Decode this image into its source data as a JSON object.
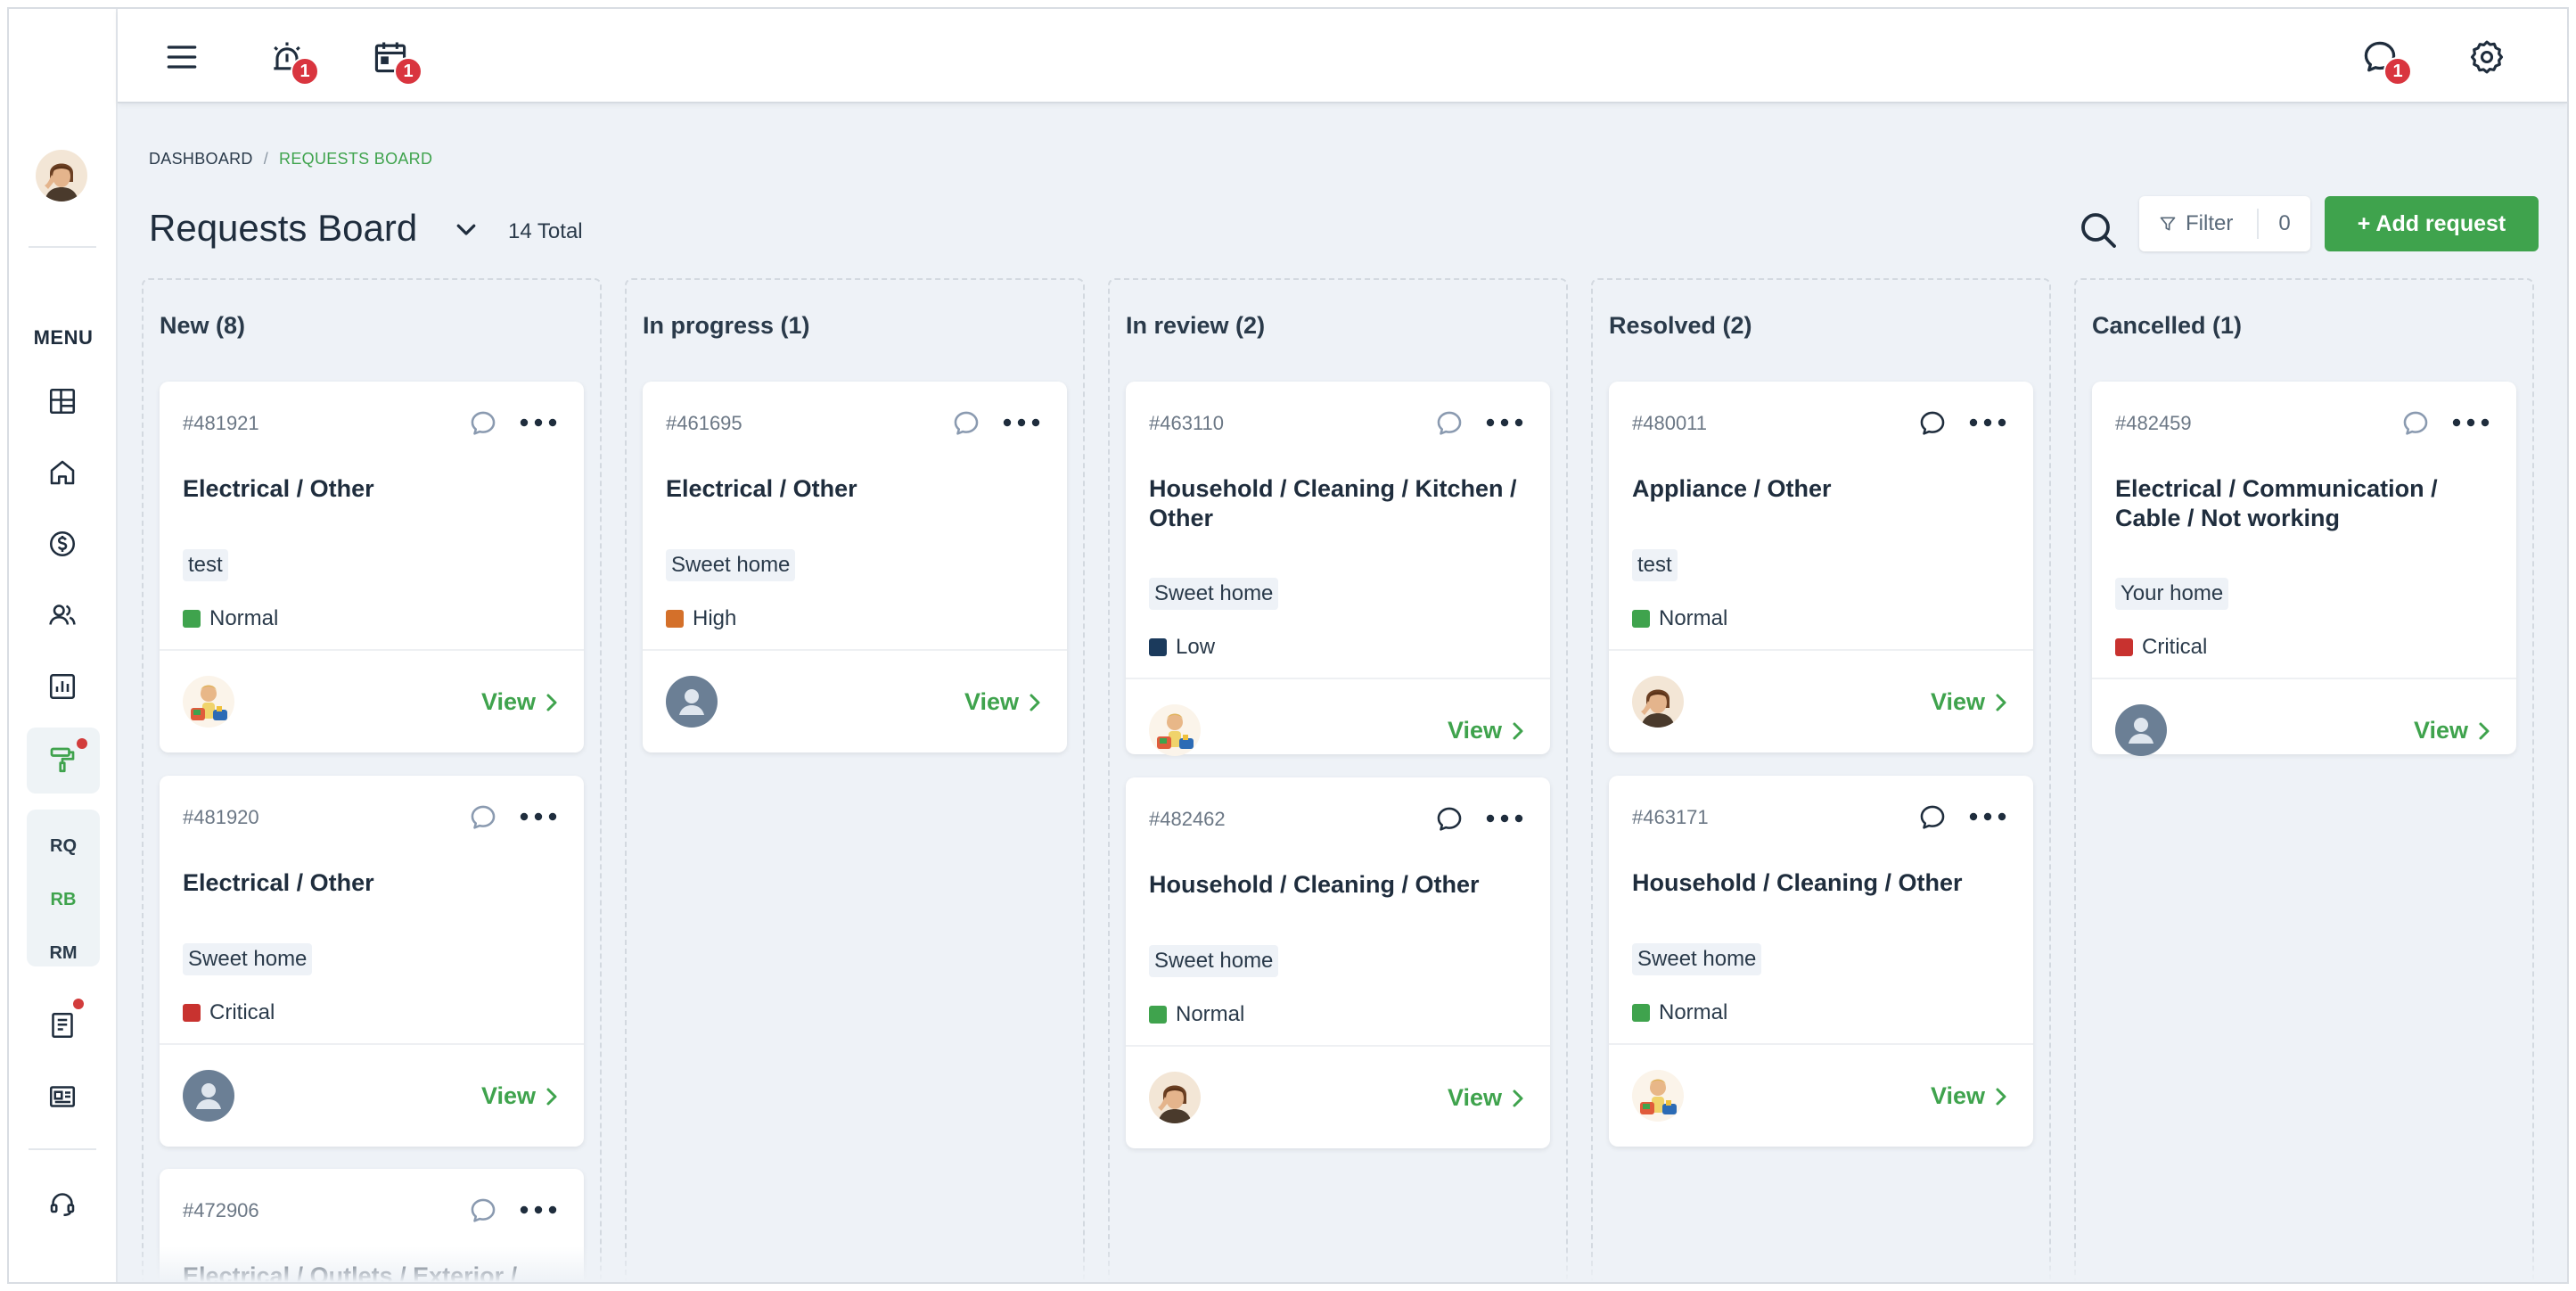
{
  "topbar": {
    "alarm_badge": "1",
    "calendar_badge": "1",
    "chat_badge": "1"
  },
  "sidebar": {
    "menu_label": "MENU",
    "sub_items": [
      "RQ",
      "RB",
      "RM"
    ]
  },
  "breadcrumb": {
    "items": [
      "DASHBOARD",
      "REQUESTS BOARD"
    ],
    "separator": "/"
  },
  "header": {
    "title": "Requests Board",
    "total": "14 Total",
    "filter_label": "Filter",
    "filter_count": "0",
    "add_label": "+ Add request"
  },
  "colors": {
    "accent": "#3fa34d",
    "normal": "#3fa34d",
    "high": "#d4702a",
    "low": "#1b3a5c",
    "critical": "#c8322f"
  },
  "columns": [
    {
      "title": "New (8)",
      "cards": [
        {
          "id": "#481921",
          "title": "Electrical / Other",
          "tag": "test",
          "priority": "Normal",
          "view": "View"
        },
        {
          "id": "#481920",
          "title": "Electrical / Other",
          "tag": "Sweet home",
          "priority": "Critical",
          "view": "View"
        },
        {
          "id": "#472906",
          "title": "Electrical / Outlets / Exterior / Not"
        }
      ]
    },
    {
      "title": "In progress (1)",
      "cards": [
        {
          "id": "#461695",
          "title": "Electrical / Other",
          "tag": "Sweet home",
          "priority": "High",
          "view": "View"
        }
      ]
    },
    {
      "title": "In review (2)",
      "cards": [
        {
          "id": "#463110",
          "title": "Household / Cleaning / Kitchen / Other",
          "tag": "Sweet home",
          "priority": "Low",
          "view": "View"
        },
        {
          "id": "#482462",
          "title": "Household / Cleaning / Other",
          "tag": "Sweet home",
          "priority": "Normal",
          "view": "View"
        }
      ]
    },
    {
      "title": "Resolved (2)",
      "cards": [
        {
          "id": "#480011",
          "title": "Appliance / Other",
          "tag": "test",
          "priority": "Normal",
          "view": "View"
        },
        {
          "id": "#463171",
          "title": "Household / Cleaning / Other",
          "tag": "Sweet home",
          "priority": "Normal",
          "view": "View"
        }
      ]
    },
    {
      "title": "Cancelled (1)",
      "cards": [
        {
          "id": "#482459",
          "title": "Electrical / Communication / Cable / Not working",
          "tag": "Your home",
          "priority": "Critical",
          "view": "View"
        }
      ]
    }
  ]
}
